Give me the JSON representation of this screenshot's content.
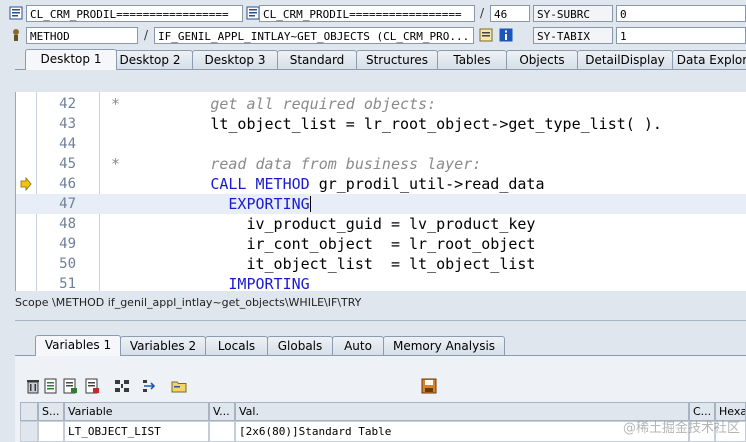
{
  "top_fields": {
    "row1": {
      "program": "CL_CRM_PRODIL=================",
      "include": "CL_CRM_PRODIL=================",
      "separator": "/",
      "line": "46",
      "sysvar_name": "SY-SUBRC",
      "sysvar_value": "0"
    },
    "row2": {
      "event_type": "METHOD",
      "separator": "/",
      "event_name": "IF_GENIL_APPL_INTLAY~GET_OBJECTS (CL_CRM_PRO...",
      "sysvar_name": "SY-TABIX",
      "sysvar_value": "1"
    }
  },
  "desktop_tabs": [
    "Desktop 1",
    "Desktop 2",
    "Desktop 3",
    "Standard",
    "Structures",
    "Tables",
    "Objects",
    "DetailDisplay",
    "Data Explor"
  ],
  "code_lines": [
    {
      "num": "42",
      "text": "*          get all required objects:",
      "type": "comment"
    },
    {
      "num": "43",
      "text": "           lt_object_list = lr_root_object->get_type_list( ).",
      "type": "code"
    },
    {
      "num": "44",
      "text": "",
      "type": "code"
    },
    {
      "num": "45",
      "text": "*          read data from business layer:",
      "type": "comment"
    },
    {
      "num": "46",
      "pre": "           ",
      "kw": "CALL METHOD",
      "post": " gr_prodil_util->read_data",
      "type": "kwline"
    },
    {
      "num": "47",
      "pre": "             ",
      "kw": "EXPORTING",
      "post": "",
      "type": "kwline"
    },
    {
      "num": "48",
      "text": "               iv_product_guid = lv_product_key",
      "type": "code"
    },
    {
      "num": "49",
      "text": "               ir_cont_object  = lr_root_object",
      "type": "code"
    },
    {
      "num": "50",
      "text": "               it_object_list  = lt_object_list",
      "type": "code"
    },
    {
      "num": "51",
      "pre": "             ",
      "kw": "IMPORTING",
      "post": "",
      "type": "kwline"
    }
  ],
  "scope_text": "Scope \\METHOD if_genil_appl_intlay~get_objects\\WHILE\\IF\\TRY",
  "variable_tabs": [
    "Variables 1",
    "Variables 2",
    "Locals",
    "Globals",
    "Auto",
    "Memory Analysis"
  ],
  "grid": {
    "headers": [
      "S...",
      "Variable",
      "V...",
      "Val.",
      "C...",
      "Hexade"
    ],
    "row": {
      "variable": "LT_OBJECT_LIST",
      "value": "[2x6(80)]Standard Table"
    }
  },
  "watermark": "@稀土掘金技术社区",
  "colors": {
    "keyword": "#1a1ad0",
    "comment": "#8a8a8a",
    "current_line": "#e8eef7",
    "background": "#dfe6ee"
  }
}
